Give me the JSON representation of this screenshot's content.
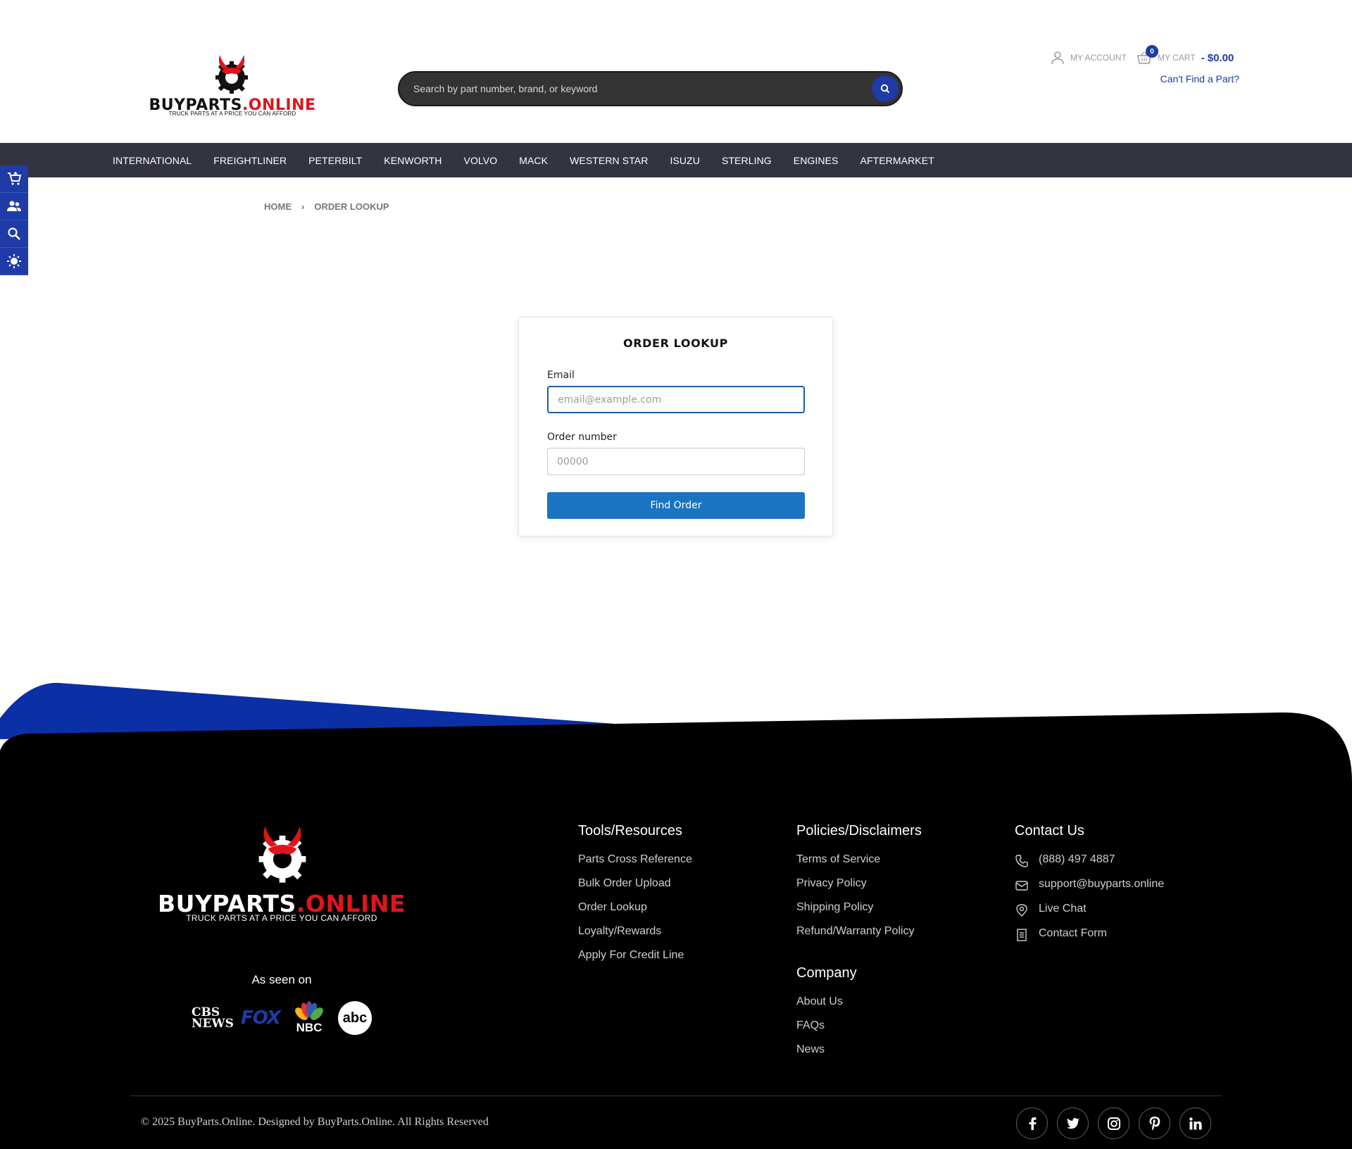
{
  "header": {
    "logo_brand_black": "BUYPARTS",
    "logo_brand_red": ".ONLINE",
    "logo_tagline": "TRUCK PARTS AT A PRICE YOU CAN AFFORD",
    "search_placeholder": "Search by part number, brand, or keyword",
    "account_label": "MY ACCOUNT",
    "cart_label": "MY CART",
    "cart_count": "0",
    "cart_total": "- $0.00",
    "cant_find": "Can't Find a Part?"
  },
  "nav": {
    "items": [
      "INTERNATIONAL",
      "FREIGHTLINER",
      "PETERBILT",
      "KENWORTH",
      "VOLVO",
      "MACK",
      "WESTERN STAR",
      "ISUZU",
      "STERLING",
      "ENGINES",
      "AFTERMARKET"
    ]
  },
  "sidetools": [
    "cart-add-icon",
    "users-icon",
    "search-icon",
    "brightness-icon"
  ],
  "breadcrumb": {
    "home": "HOME",
    "separator": "›",
    "current": "ORDER LOOKUP"
  },
  "form": {
    "title": "ORDER LOOKUP",
    "email_label": "Email",
    "email_placeholder": "email@example.com",
    "order_label": "Order number",
    "order_placeholder": "00000",
    "submit_label": "Find Order"
  },
  "footer": {
    "logo_brand_white": "BUYPARTS",
    "logo_brand_red": ".ONLINE",
    "logo_tagline": "TRUCK PARTS AT A PRICE YOU CAN AFFORD",
    "as_seen_on": "As seen on",
    "media": {
      "cbs_line1": "CBS",
      "cbs_line2": "NEWS",
      "fox": "FOX",
      "nbc": "NBC",
      "abc": "abc"
    },
    "tools": {
      "heading": "Tools/Resources",
      "links": [
        "Parts Cross Reference",
        "Bulk Order Upload",
        "Order Lookup",
        "Loyalty/Rewards",
        "Apply For Credit Line"
      ]
    },
    "policies": {
      "heading": "Policies/Disclaimers",
      "links": [
        "Terms of Service",
        "Privacy Policy",
        "Shipping Policy",
        "Refund/Warranty Policy"
      ]
    },
    "company": {
      "heading": "Company",
      "links": [
        "About Us",
        "FAQs",
        "News"
      ]
    },
    "contact": {
      "heading": "Contact Us",
      "phone": "(888) 497 4887",
      "email": "support@buyparts.online",
      "chat": "Live Chat",
      "form": "Contact Form"
    },
    "copyright": "© 2025 BuyParts.Online. Designed by BuyParts.Online. All Rights Reserved",
    "social": [
      "facebook-icon",
      "twitter-icon",
      "instagram-icon",
      "pinterest-icon",
      "linkedin-icon"
    ]
  },
  "colors": {
    "brand_blue": "#1e3ba7",
    "brand_red": "#e0141c",
    "nav_bg": "#333440",
    "button_blue": "#1b74c1",
    "footer_bg": "#000000"
  }
}
